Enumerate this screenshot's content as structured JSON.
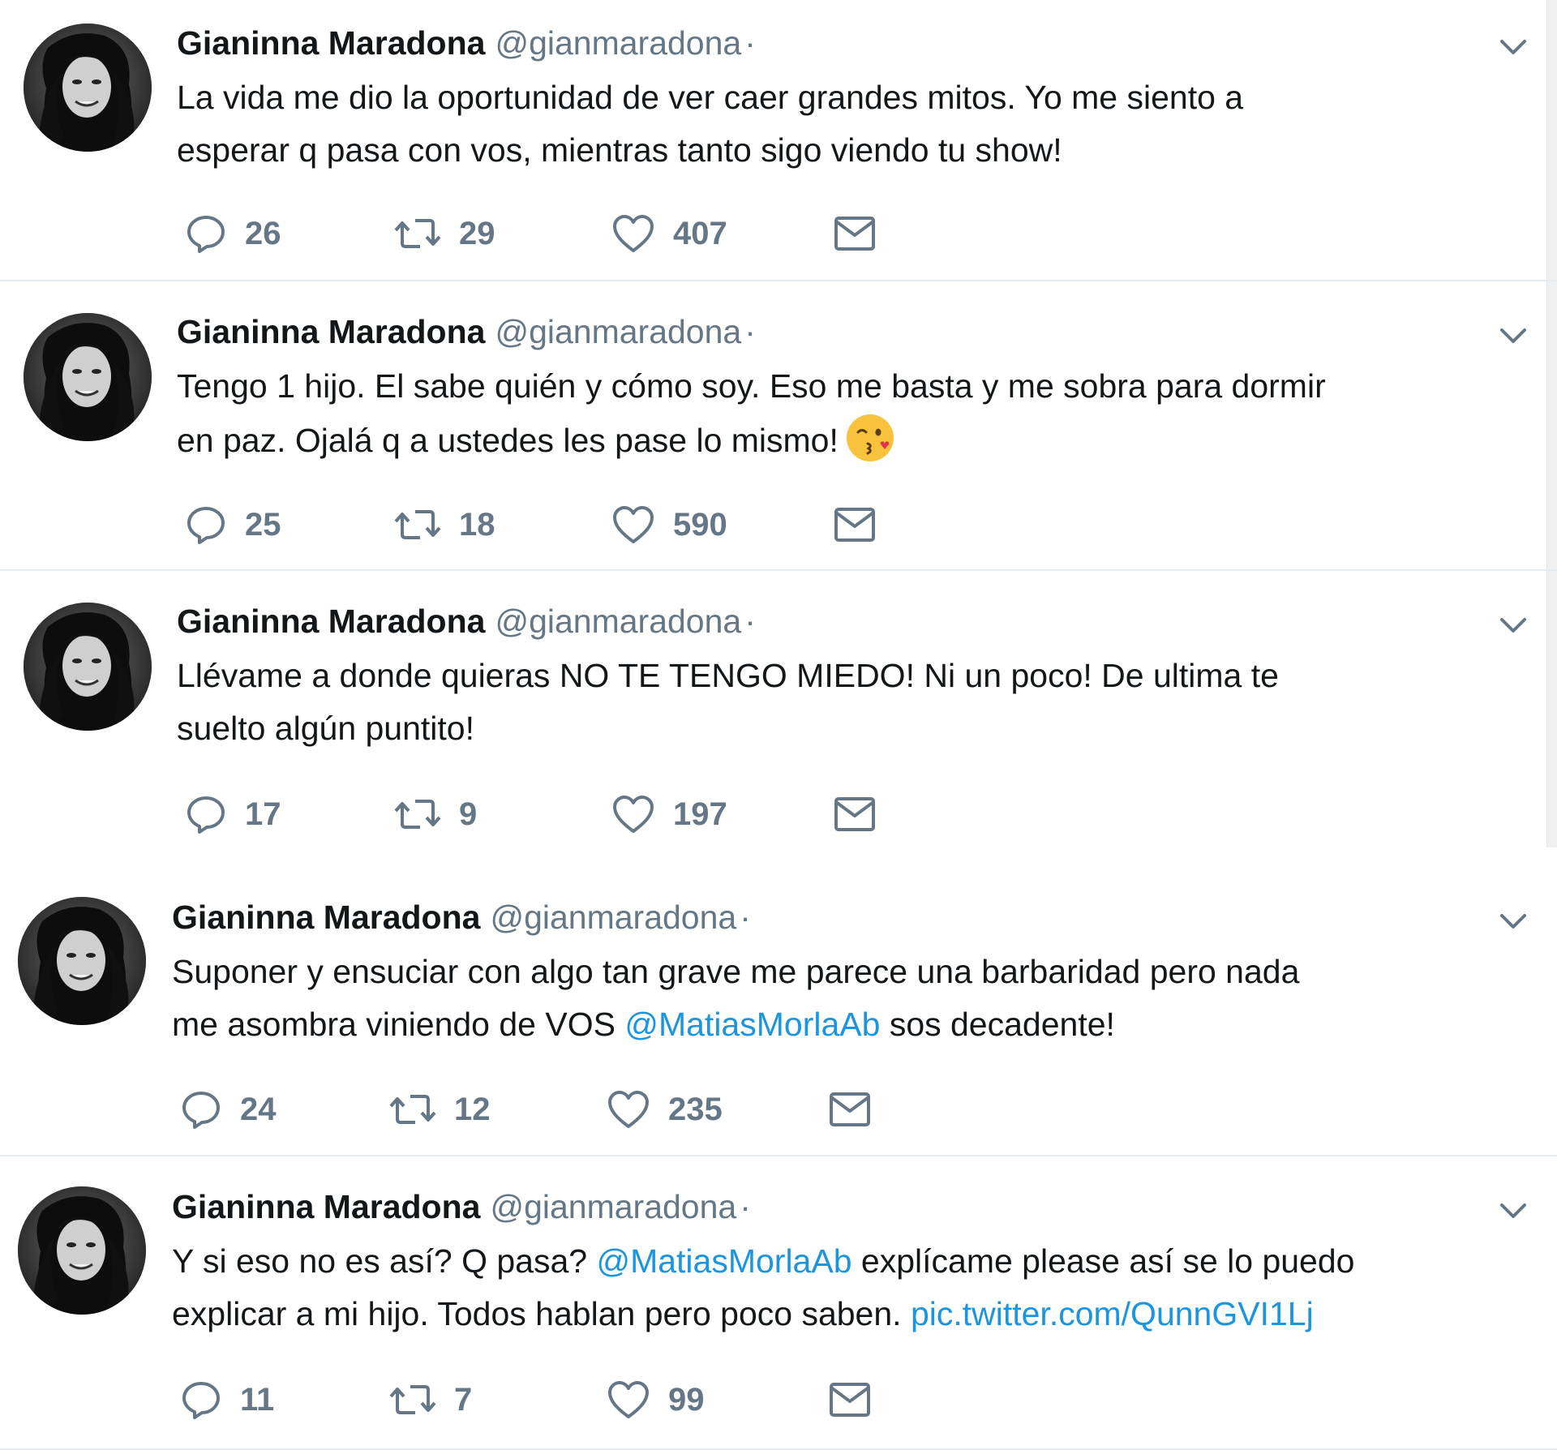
{
  "author": {
    "name": "Gianinna Maradona",
    "handle": "@gianmaradona",
    "separator": "·"
  },
  "colors": {
    "text": "#14171a",
    "secondary": "#657786",
    "link": "#1b95e0",
    "divider": "#e6ecf0"
  },
  "icons": {
    "reply": "reply-icon",
    "retweet": "retweet-icon",
    "like": "heart-icon",
    "dm": "envelope-icon",
    "more": "chevron-down-icon",
    "emoji": "kissing-face-emoji"
  },
  "tweets": [
    {
      "lines": [
        [
          {
            "t": "La vida me dio la oportunidad de ver caer grandes mitos. Yo me siento a"
          }
        ],
        [
          {
            "t": "esperar q pasa con vos, mientras tanto sigo viendo tu show!"
          }
        ]
      ],
      "replies": "26",
      "retweets": "29",
      "likes": "407"
    },
    {
      "lines": [
        [
          {
            "t": "Tengo 1 hijo. El sabe quién y cómo soy. Eso me basta y me sobra para dormir"
          }
        ],
        [
          {
            "t": "en paz. Ojalá q a ustedes les pase lo mismo!"
          }
        ]
      ],
      "replies": "25",
      "retweets": "18",
      "likes": "590"
    },
    {
      "lines": [
        [
          {
            "t": "Llévame a donde quieras NO TE TENGO MIEDO! Ni un poco! De ultima te"
          }
        ],
        [
          {
            "t": "suelto algún puntito!"
          }
        ]
      ],
      "replies": "17",
      "retweets": "9",
      "likes": "197"
    },
    {
      "lines": [
        [
          {
            "t": "Suponer y ensuciar con algo tan grave me parece una barbaridad pero nada"
          }
        ],
        [
          {
            "t": "me asombra viniendo de VOS "
          },
          {
            "t": "@MatiasMorlaAb",
            "link": true
          },
          {
            "t": " sos decadente!"
          }
        ]
      ],
      "replies": "24",
      "retweets": "12",
      "likes": "235"
    },
    {
      "lines": [
        [
          {
            "t": "Y si eso no es así? Q pasa? "
          },
          {
            "t": "@MatiasMorlaAb",
            "link": true
          },
          {
            "t": " explícame please así se lo puedo"
          }
        ],
        [
          {
            "t": "explicar a mi hijo. Todos hablan pero poco saben. "
          },
          {
            "t": "pic.twitter.com/QunnGVI1Lj",
            "link": true
          }
        ]
      ],
      "replies": "11",
      "retweets": "7",
      "likes": "99"
    }
  ]
}
